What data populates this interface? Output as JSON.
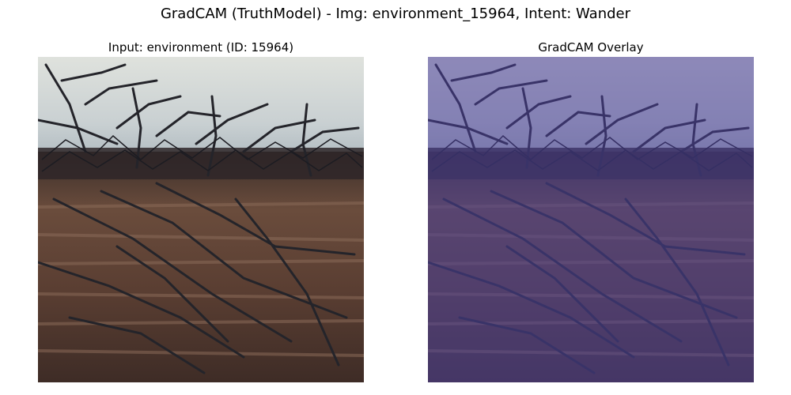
{
  "suptitle": "GradCAM (TruthModel) - Img: environment_15964, Intent: Wander",
  "panels": {
    "input": {
      "title": "Input: environment (ID: 15964)",
      "image": "photo of bare tangled tree branches over brown ground under an overcast sky"
    },
    "overlay": {
      "title": "GradCAM Overlay",
      "image": "same photo tinted with a uniform purple-blue GradCAM heatmap overlay",
      "tint_color": "#4a3f9a"
    }
  },
  "colors": {
    "sky": "#d8dcd8",
    "ground": "#6b4a3a",
    "branches": "#2a2a30"
  }
}
